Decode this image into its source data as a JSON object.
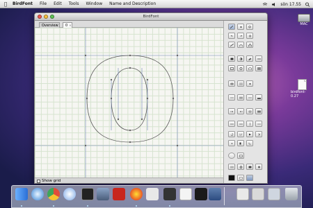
{
  "menubar": {
    "apple": "",
    "items": [
      {
        "label": "BirdFont",
        "bold": true
      },
      {
        "label": "File"
      },
      {
        "label": "Edit"
      },
      {
        "label": "Tools"
      },
      {
        "label": "Window"
      },
      {
        "label": "Name and Description"
      }
    ],
    "clock": "sön 17.55"
  },
  "desktop": {
    "drive_label": "MAC",
    "file_label": "birdfont-0.27"
  },
  "window": {
    "title": "BirdFont",
    "tabs": [
      {
        "label": "Overview",
        "active": false
      },
      {
        "label": "0",
        "active": true
      }
    ],
    "statusbar": {
      "show_grid_label": "Show grid"
    }
  },
  "icons": {
    "toolbox": "drawing-tool-icons",
    "dock": [
      "finder",
      "safari",
      "chrome",
      "itunes",
      "terminal",
      "dashboard",
      "filezilla",
      "app-red",
      "calendar",
      "wifi",
      "preview",
      "textedit",
      "app-3",
      "downloads",
      "trash"
    ]
  },
  "colors": {
    "accent": "#4a72b8",
    "grid": "#d6e3cf",
    "canvas": "#f6f6f2",
    "glyph_stroke": "#555555",
    "guide": "#6f86b6"
  }
}
